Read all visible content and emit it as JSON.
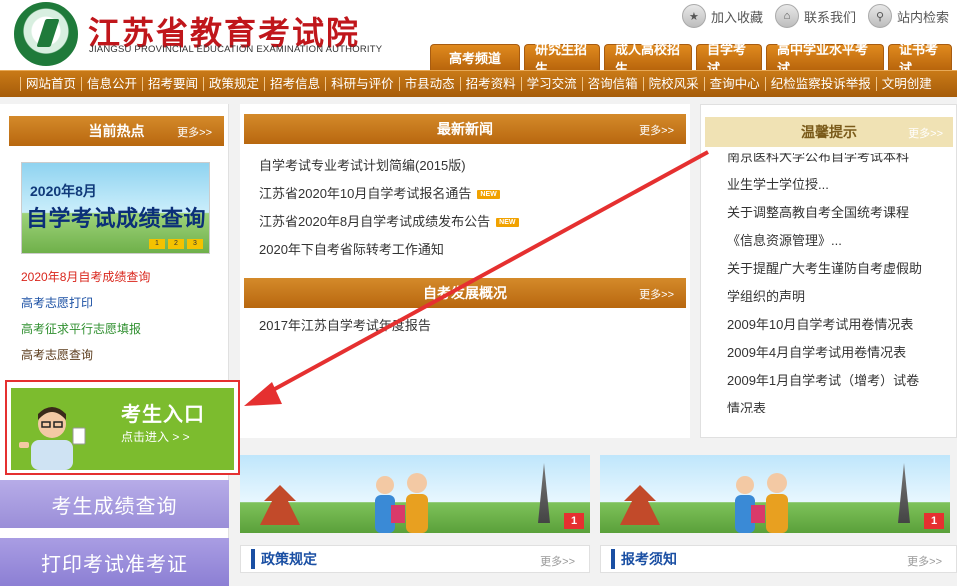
{
  "header": {
    "title": "江苏省教育考试院",
    "subtitle": "JIANGSU PROVINCIAL EDUCATION EXAMINATION AUTHORITY",
    "toplinks": [
      "加入收藏",
      "联系我们",
      "站内检索"
    ]
  },
  "tabs": [
    "高考频道",
    "研究生招生",
    "成人高校招生",
    "自学考试",
    "高中学业水平考试",
    "证书考试"
  ],
  "nav": [
    "网站首页",
    "信息公开",
    "招考要闻",
    "政策规定",
    "招考信息",
    "科研与评价",
    "市县动态",
    "招考资料",
    "学习交流",
    "咨询信箱",
    "院校风采",
    "查询中心",
    "纪检监察投诉举报",
    "文明创建"
  ],
  "left": {
    "head": "当前热点",
    "more": "更多>>",
    "promo": {
      "line1": "2020年8月",
      "line2": "自学考试成绩查询",
      "steps": [
        "1",
        "2",
        "3"
      ]
    },
    "links": [
      {
        "text": "2020年8月自考成绩查询",
        "color": "#d9261c"
      },
      {
        "text": "高考志愿打印",
        "color": "#1a4fa3"
      },
      {
        "text": "高考征求平行志愿填报",
        "color": "#2f8f2f"
      },
      {
        "text": "高考志愿查询",
        "color": "#5a3a1a"
      }
    ],
    "entry": {
      "title": "考生入口",
      "sub": "点击进入 > >"
    },
    "scores_btn": "考生成绩查询",
    "print_btn": "打印考试准考证"
  },
  "middle": {
    "news_head": "最新新闻",
    "more": "更多>>",
    "news": [
      {
        "text": "自学考试专业考试计划简编(2015版)",
        "new": false
      },
      {
        "text": "江苏省2020年10月自学考试报名通告",
        "new": true
      },
      {
        "text": "江苏省2020年8月自学考试成绩发布公告",
        "new": true
      },
      {
        "text": "2020年下自考省际转考工作通知",
        "new": false
      }
    ],
    "new_badge": "NEW",
    "dev_head": "自考发展概况",
    "dev": [
      "2017年江苏自学考试年度报告"
    ]
  },
  "right": {
    "head": "温馨提示",
    "more": "更多>>",
    "tips": [
      "南京医科大学公布自学考试本科",
      "业生学士学位授...",
      "关于调整高教自考全国统考课程",
      "《信息资源管理》...",
      "关于提醒广大考生谨防自考虚假助",
      "学组织的声明",
      "2009年10月自学考试用卷情况表",
      "2009年4月自学考试用卷情况表",
      "2009年1月自学考试（增考）试卷",
      "情况表"
    ]
  },
  "banners": [
    {
      "num": "1"
    },
    {
      "num": "1"
    }
  ],
  "bottom": [
    {
      "title": "政策规定",
      "more": "更多>>"
    },
    {
      "title": "报考须知",
      "more": "更多>>"
    }
  ],
  "colors": {
    "brand_red": "#c0161b",
    "orange": "#b8650c",
    "green_entry": "#7cbc2e",
    "purple": "#9a8ed8",
    "annotation_red": "#e53030"
  }
}
